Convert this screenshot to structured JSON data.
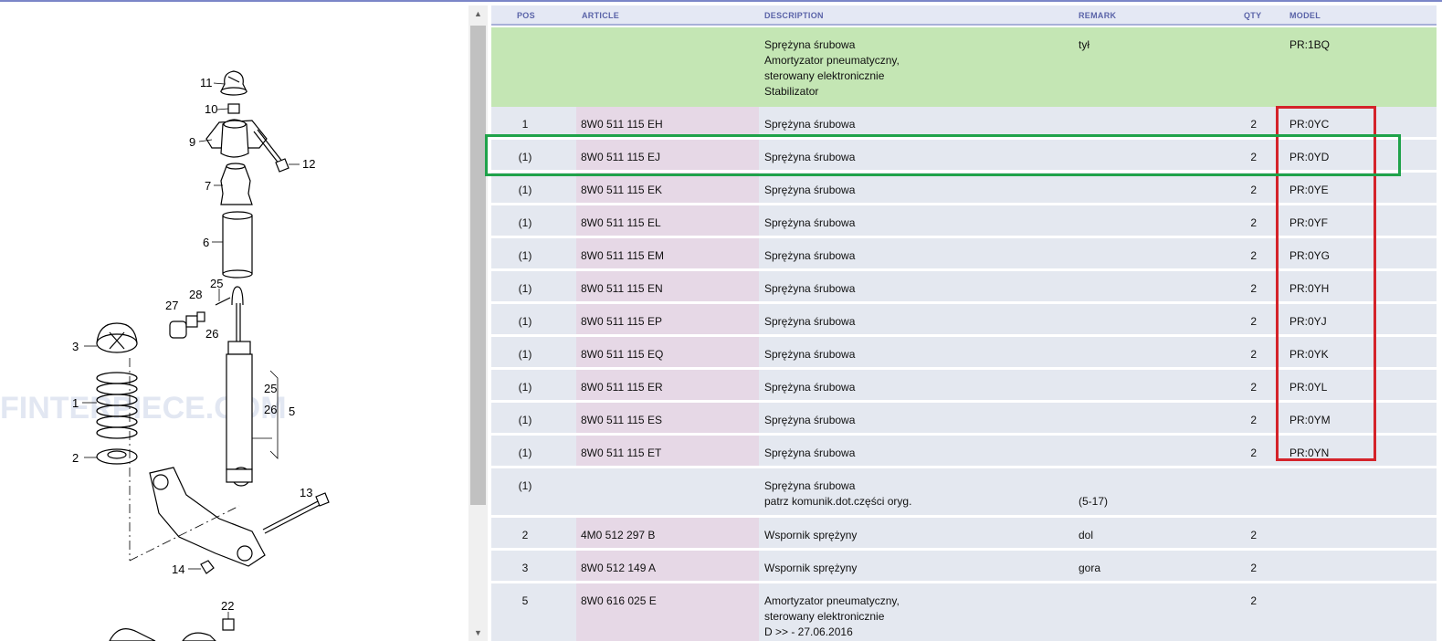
{
  "diagram": {
    "callouts": [
      "11",
      "10",
      "9",
      "12",
      "7",
      "6",
      "25",
      "28",
      "27",
      "26",
      "3",
      "1",
      "2",
      "25",
      "26",
      "5",
      "13",
      "14",
      "22"
    ],
    "watermark": "FINTERPIECE.COM"
  },
  "table": {
    "headers": {
      "pos": "POS",
      "article": "ARTICLE",
      "description": "DESCRIPTION",
      "remark": "REMARK",
      "qty": "QTY",
      "model": "MODEL"
    },
    "rows": [
      {
        "pos": "",
        "article": "",
        "description": [
          "Sprężyna śrubowa",
          "Amortyzator pneumatyczny,",
          "sterowany elektronicznie",
          "Stabilizator"
        ],
        "remark": "tył",
        "qty": "",
        "model": "PR:1BQ",
        "highlight": "green"
      },
      {
        "pos": "1",
        "article": "8W0 511 115 EH",
        "description": [
          "Sprężyna śrubowa"
        ],
        "remark": "",
        "qty": "2",
        "model": "PR:0YC"
      },
      {
        "pos": "(1)",
        "article": "8W0 511 115 EJ",
        "description": [
          "Sprężyna śrubowa"
        ],
        "remark": "",
        "qty": "2",
        "model": "PR:0YD"
      },
      {
        "pos": "(1)",
        "article": "8W0 511 115 EK",
        "description": [
          "Sprężyna śrubowa"
        ],
        "remark": "",
        "qty": "2",
        "model": "PR:0YE"
      },
      {
        "pos": "(1)",
        "article": "8W0 511 115 EL",
        "description": [
          "Sprężyna śrubowa"
        ],
        "remark": "",
        "qty": "2",
        "model": "PR:0YF"
      },
      {
        "pos": "(1)",
        "article": "8W0 511 115 EM",
        "description": [
          "Sprężyna śrubowa"
        ],
        "remark": "",
        "qty": "2",
        "model": "PR:0YG"
      },
      {
        "pos": "(1)",
        "article": "8W0 511 115 EN",
        "description": [
          "Sprężyna śrubowa"
        ],
        "remark": "",
        "qty": "2",
        "model": "PR:0YH"
      },
      {
        "pos": "(1)",
        "article": "8W0 511 115 EP",
        "description": [
          "Sprężyna śrubowa"
        ],
        "remark": "",
        "qty": "2",
        "model": "PR:0YJ"
      },
      {
        "pos": "(1)",
        "article": "8W0 511 115 EQ",
        "description": [
          "Sprężyna śrubowa"
        ],
        "remark": "",
        "qty": "2",
        "model": "PR:0YK"
      },
      {
        "pos": "(1)",
        "article": "8W0 511 115 ER",
        "description": [
          "Sprężyna śrubowa"
        ],
        "remark": "",
        "qty": "2",
        "model": "PR:0YL"
      },
      {
        "pos": "(1)",
        "article": "8W0 511 115 ES",
        "description": [
          "Sprężyna śrubowa"
        ],
        "remark": "",
        "qty": "2",
        "model": "PR:0YM"
      },
      {
        "pos": "(1)",
        "article": "8W0 511 115 ET",
        "description": [
          "Sprężyna śrubowa"
        ],
        "remark": "",
        "qty": "2",
        "model": "PR:0YN"
      },
      {
        "pos": "(1)",
        "article": "",
        "description": [
          "Sprężyna śrubowa",
          "patrz komunik.dot.części oryg."
        ],
        "remark": [
          "",
          "(5-17)"
        ],
        "qty": "",
        "model": ""
      },
      {
        "pos": "2",
        "article": "4M0 512 297 B",
        "description": [
          "Wspornik sprężyny"
        ],
        "remark": "dol",
        "qty": "2",
        "model": ""
      },
      {
        "pos": "3",
        "article": "8W0 512 149 A",
        "description": [
          "Wspornik sprężyny"
        ],
        "remark": "gora",
        "qty": "2",
        "model": ""
      },
      {
        "pos": "5",
        "article": "8W0 616 025 E",
        "description": [
          "Amortyzator pneumatyczny,",
          "sterowany elektronicznie",
          "D            >> - 27.06.2016"
        ],
        "remark": "",
        "qty": "2",
        "model": ""
      }
    ]
  },
  "colors": {
    "row_green": "#c4e6b4",
    "row_default": "#e4e8f0",
    "article_col": "#e6d8e6",
    "red_box": "#d4232a",
    "green_box": "#1fa24a"
  },
  "scrollbar": {
    "up": "▲",
    "down": "▼"
  }
}
